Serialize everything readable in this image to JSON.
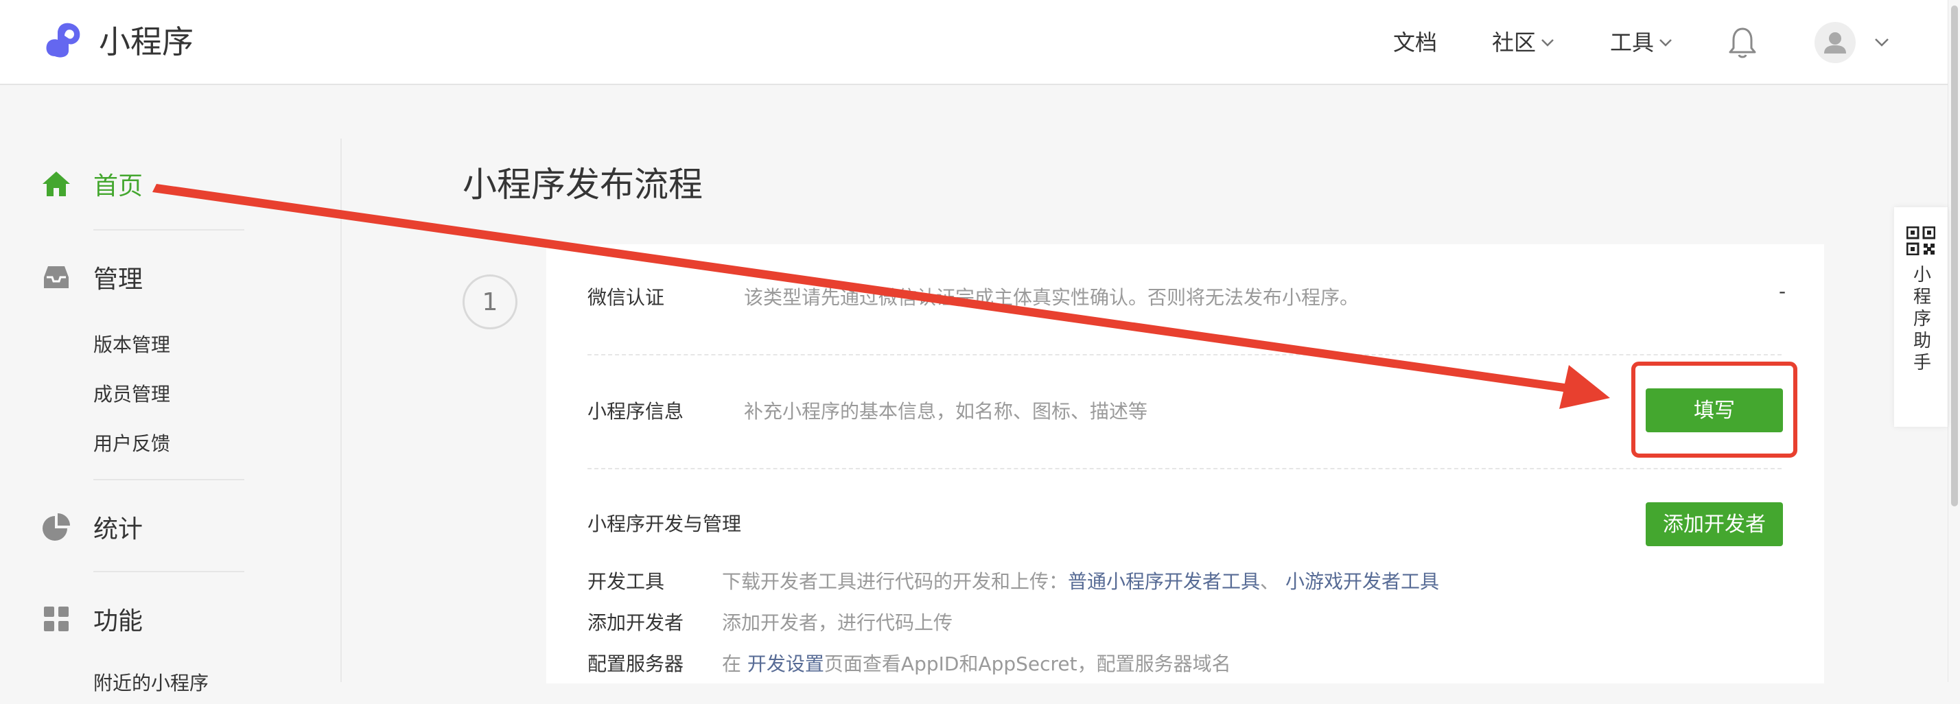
{
  "header": {
    "brand": "小程序",
    "nav": [
      {
        "label": "文档"
      },
      {
        "label": "社区"
      },
      {
        "label": "工具"
      }
    ]
  },
  "sidebar": {
    "groups": [
      {
        "label": "首页",
        "icon": "home-icon",
        "active": true
      },
      {
        "label": "管理",
        "icon": "inbox-icon"
      },
      {
        "label": "统计",
        "icon": "pie-chart-icon"
      },
      {
        "label": "功能",
        "icon": "grid-icon"
      }
    ],
    "management_items": [
      "版本管理",
      "成员管理",
      "用户反馈"
    ],
    "cut_item": "附近的小程序"
  },
  "main": {
    "title": "小程序发布流程",
    "step_number": "1",
    "rows": [
      {
        "label": "微信认证",
        "desc": "该类型请先通过微信认证完成主体真实性确认。否则将无法发布小程序。",
        "status": "-"
      },
      {
        "label": "小程序信息",
        "desc": "补充小程序的基本信息，如名称、图标、描述等",
        "button": "填写"
      }
    ],
    "dev_section": {
      "title": "小程序开发与管理",
      "button": "添加开发者",
      "details": [
        {
          "label": "开发工具",
          "text": "下载开发者工具进行代码的开发和上传：",
          "link1": "普通小程序开发者工具",
          "sep": "、 ",
          "link2": "小游戏开发者工具"
        },
        {
          "label": "添加开发者",
          "text": "添加开发者，进行代码上传"
        },
        {
          "label": "配置服务器",
          "pre": "在 ",
          "link": "开发设置",
          "post": "页面查看AppID和AppSecret，配置服务器域名"
        }
      ]
    }
  },
  "assistant": {
    "label": "小程序助手"
  },
  "colors": {
    "accent_green": "#44a72f",
    "annotation_red": "#e8402f",
    "link_blue": "#576b95",
    "logo_purple": "#6467f0"
  }
}
